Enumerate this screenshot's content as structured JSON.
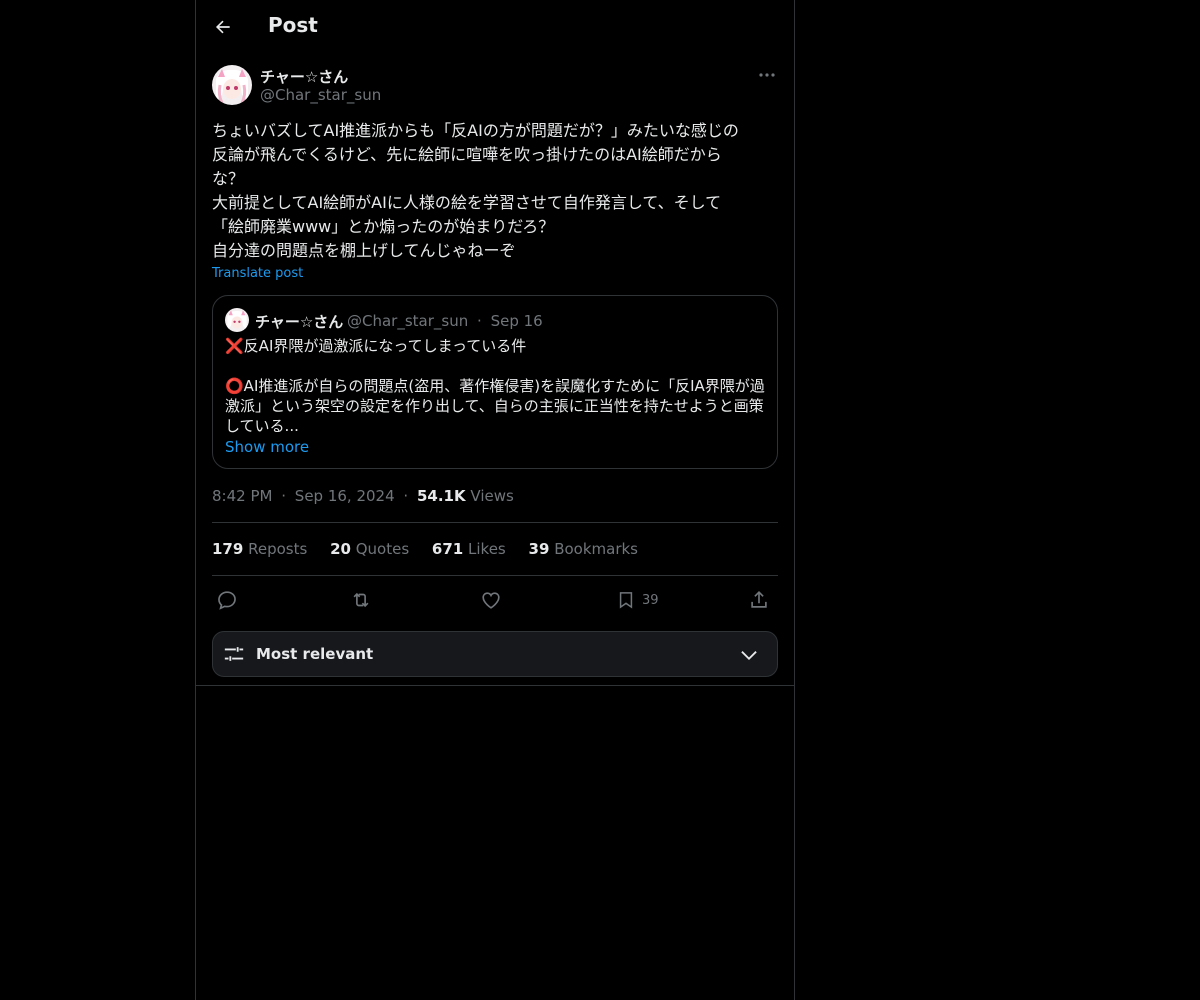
{
  "topbar": {
    "title": "Post"
  },
  "author": {
    "display_name": "チャー☆さん",
    "handle": "@Char_star_sun"
  },
  "post": {
    "text": "ちょいバズしてAI推進派からも「反AIの方が問題だが？」みたいな感じの\n反論が飛んでくるけど、先に絵師に喧嘩を吹っ掛けたのはAI絵師だから\nな？\n大前提としてAI絵師がAIに人様の絵を学習させて自作発言して、そして\n「絵師廃業www」とか煽ったのが始まりだろ？\n自分達の問題点を棚上げしてんじゃねーぞ",
    "translate_label": "Translate post"
  },
  "quote": {
    "display_name": "チャー☆さん",
    "handle": "@Char_star_sun",
    "separator": "·",
    "date": "Sep 16",
    "text": "❌反AI界隈が過激派になってしまっている件\n\n⭕AI推進派が自らの問題点(盗用、著作権侵害)を誤魔化すために「反IA界隈が過\n激派」という架空の設定を作り出して、自らの主張に正当性を持たせようと画策\nしている...",
    "show_more": "Show more"
  },
  "meta": {
    "time": "8:42 PM",
    "sep1": "·",
    "date": "Sep 16, 2024",
    "sep2": "·",
    "views_count": "54.1K",
    "views_label": "Views"
  },
  "stats": {
    "reposts_count": "179",
    "reposts_label": "Reposts",
    "quotes_count": "20",
    "quotes_label": "Quotes",
    "likes_count": "671",
    "likes_label": "Likes",
    "bookmarks_count": "39",
    "bookmarks_label": "Bookmarks"
  },
  "actions": {
    "reply_icon": "reply-icon",
    "repost_icon": "repost-icon",
    "like_icon": "heart-icon",
    "bookmark_icon": "bookmark-icon",
    "bookmark_count": "39",
    "share_icon": "share-icon"
  },
  "sort": {
    "label": "Most relevant"
  },
  "colors": {
    "background": "#000000",
    "text": "#e7e9ea",
    "muted": "#71767b",
    "accent": "#1d9bf0",
    "border": "#2f3336"
  }
}
